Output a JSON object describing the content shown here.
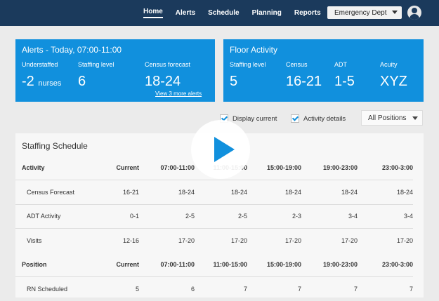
{
  "nav": {
    "items": [
      "Home",
      "Alerts",
      "Schedule",
      "Planning",
      "Reports"
    ],
    "department": "Emergency Dept"
  },
  "alerts_card": {
    "title": "Alerts - Today, 07:00-11:00",
    "understaffed_label": "Understaffed",
    "understaffed_value": "-2",
    "understaffed_unit": "nurses",
    "staffing_label": "Staffing level",
    "staffing_value": "6",
    "census_label": "Census forecast",
    "census_value": "18-24",
    "more_link": "View 3 more alerts"
  },
  "floor_card": {
    "title": "Floor Activity",
    "staffing_label": "Staffing level",
    "staffing_value": "5",
    "census_label": "Census",
    "census_value": "16-21",
    "adt_label": "ADT",
    "adt_value": "1-5",
    "acuity_label": "Acuity",
    "acuity_value": "XYZ"
  },
  "controls": {
    "display_current": "Display current",
    "activity_details": "Activity details",
    "positions": "All Positions"
  },
  "schedule": {
    "title": "Staffing Schedule",
    "rows": [
      {
        "kind": "head",
        "cells": [
          "Activity",
          "Current",
          "07:00-11:00",
          "11:00-15:00",
          "15:00-19:00",
          "19:00-23:00",
          "23:00-3:00"
        ]
      },
      {
        "kind": "sub",
        "cells": [
          "Census Forecast",
          "16-21",
          "18-24",
          "18-24",
          "18-24",
          "18-24",
          "18-24"
        ]
      },
      {
        "kind": "sub",
        "cells": [
          "ADT Activity",
          "0-1",
          "2-5",
          "2-5",
          "2-3",
          "3-4",
          "3-4"
        ]
      },
      {
        "kind": "sub",
        "cells": [
          "Visits",
          "12-16",
          "17-20",
          "17-20",
          "17-20",
          "17-20",
          "17-20"
        ]
      },
      {
        "kind": "head",
        "cells": [
          "Position",
          "Current",
          "07:00-11:00",
          "11:00-15:00",
          "15:00-19:00",
          "19:00-23:00",
          "23:00-3:00"
        ]
      },
      {
        "kind": "sub",
        "cells": [
          "RN Scheduled",
          "5",
          "6",
          "7",
          "7",
          "7",
          "7"
        ]
      }
    ]
  },
  "colors": {
    "topbar": "#1b3a5c",
    "card": "#1190dd"
  },
  "icons": {
    "avatar": "user-icon",
    "play": "play-icon"
  }
}
